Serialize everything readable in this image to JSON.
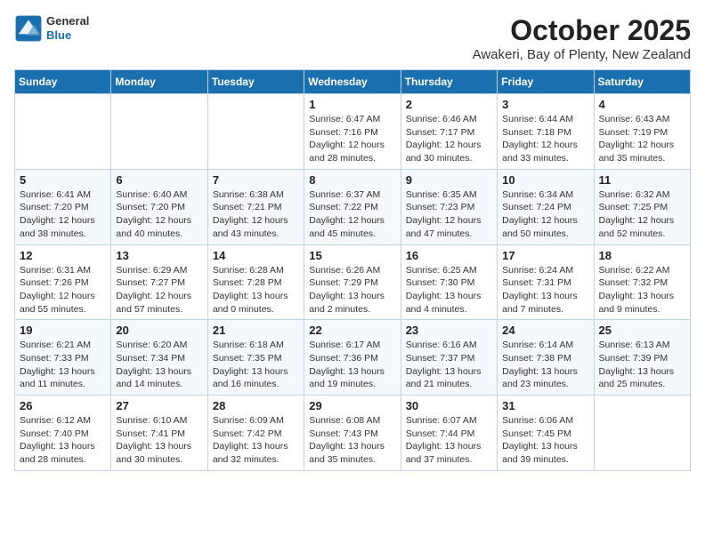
{
  "header": {
    "logo_general": "General",
    "logo_blue": "Blue",
    "month_title": "October 2025",
    "location": "Awakeri, Bay of Plenty, New Zealand"
  },
  "days_of_week": [
    "Sunday",
    "Monday",
    "Tuesday",
    "Wednesday",
    "Thursday",
    "Friday",
    "Saturday"
  ],
  "weeks": [
    [
      {
        "day": "",
        "info": ""
      },
      {
        "day": "",
        "info": ""
      },
      {
        "day": "",
        "info": ""
      },
      {
        "day": "1",
        "info": "Sunrise: 6:47 AM\nSunset: 7:16 PM\nDaylight: 12 hours\nand 28 minutes."
      },
      {
        "day": "2",
        "info": "Sunrise: 6:46 AM\nSunset: 7:17 PM\nDaylight: 12 hours\nand 30 minutes."
      },
      {
        "day": "3",
        "info": "Sunrise: 6:44 AM\nSunset: 7:18 PM\nDaylight: 12 hours\nand 33 minutes."
      },
      {
        "day": "4",
        "info": "Sunrise: 6:43 AM\nSunset: 7:19 PM\nDaylight: 12 hours\nand 35 minutes."
      }
    ],
    [
      {
        "day": "5",
        "info": "Sunrise: 6:41 AM\nSunset: 7:20 PM\nDaylight: 12 hours\nand 38 minutes."
      },
      {
        "day": "6",
        "info": "Sunrise: 6:40 AM\nSunset: 7:20 PM\nDaylight: 12 hours\nand 40 minutes."
      },
      {
        "day": "7",
        "info": "Sunrise: 6:38 AM\nSunset: 7:21 PM\nDaylight: 12 hours\nand 43 minutes."
      },
      {
        "day": "8",
        "info": "Sunrise: 6:37 AM\nSunset: 7:22 PM\nDaylight: 12 hours\nand 45 minutes."
      },
      {
        "day": "9",
        "info": "Sunrise: 6:35 AM\nSunset: 7:23 PM\nDaylight: 12 hours\nand 47 minutes."
      },
      {
        "day": "10",
        "info": "Sunrise: 6:34 AM\nSunset: 7:24 PM\nDaylight: 12 hours\nand 50 minutes."
      },
      {
        "day": "11",
        "info": "Sunrise: 6:32 AM\nSunset: 7:25 PM\nDaylight: 12 hours\nand 52 minutes."
      }
    ],
    [
      {
        "day": "12",
        "info": "Sunrise: 6:31 AM\nSunset: 7:26 PM\nDaylight: 12 hours\nand 55 minutes."
      },
      {
        "day": "13",
        "info": "Sunrise: 6:29 AM\nSunset: 7:27 PM\nDaylight: 12 hours\nand 57 minutes."
      },
      {
        "day": "14",
        "info": "Sunrise: 6:28 AM\nSunset: 7:28 PM\nDaylight: 13 hours\nand 0 minutes."
      },
      {
        "day": "15",
        "info": "Sunrise: 6:26 AM\nSunset: 7:29 PM\nDaylight: 13 hours\nand 2 minutes."
      },
      {
        "day": "16",
        "info": "Sunrise: 6:25 AM\nSunset: 7:30 PM\nDaylight: 13 hours\nand 4 minutes."
      },
      {
        "day": "17",
        "info": "Sunrise: 6:24 AM\nSunset: 7:31 PM\nDaylight: 13 hours\nand 7 minutes."
      },
      {
        "day": "18",
        "info": "Sunrise: 6:22 AM\nSunset: 7:32 PM\nDaylight: 13 hours\nand 9 minutes."
      }
    ],
    [
      {
        "day": "19",
        "info": "Sunrise: 6:21 AM\nSunset: 7:33 PM\nDaylight: 13 hours\nand 11 minutes."
      },
      {
        "day": "20",
        "info": "Sunrise: 6:20 AM\nSunset: 7:34 PM\nDaylight: 13 hours\nand 14 minutes."
      },
      {
        "day": "21",
        "info": "Sunrise: 6:18 AM\nSunset: 7:35 PM\nDaylight: 13 hours\nand 16 minutes."
      },
      {
        "day": "22",
        "info": "Sunrise: 6:17 AM\nSunset: 7:36 PM\nDaylight: 13 hours\nand 19 minutes."
      },
      {
        "day": "23",
        "info": "Sunrise: 6:16 AM\nSunset: 7:37 PM\nDaylight: 13 hours\nand 21 minutes."
      },
      {
        "day": "24",
        "info": "Sunrise: 6:14 AM\nSunset: 7:38 PM\nDaylight: 13 hours\nand 23 minutes."
      },
      {
        "day": "25",
        "info": "Sunrise: 6:13 AM\nSunset: 7:39 PM\nDaylight: 13 hours\nand 25 minutes."
      }
    ],
    [
      {
        "day": "26",
        "info": "Sunrise: 6:12 AM\nSunset: 7:40 PM\nDaylight: 13 hours\nand 28 minutes."
      },
      {
        "day": "27",
        "info": "Sunrise: 6:10 AM\nSunset: 7:41 PM\nDaylight: 13 hours\nand 30 minutes."
      },
      {
        "day": "28",
        "info": "Sunrise: 6:09 AM\nSunset: 7:42 PM\nDaylight: 13 hours\nand 32 minutes."
      },
      {
        "day": "29",
        "info": "Sunrise: 6:08 AM\nSunset: 7:43 PM\nDaylight: 13 hours\nand 35 minutes."
      },
      {
        "day": "30",
        "info": "Sunrise: 6:07 AM\nSunset: 7:44 PM\nDaylight: 13 hours\nand 37 minutes."
      },
      {
        "day": "31",
        "info": "Sunrise: 6:06 AM\nSunset: 7:45 PM\nDaylight: 13 hours\nand 39 minutes."
      },
      {
        "day": "",
        "info": ""
      }
    ]
  ]
}
